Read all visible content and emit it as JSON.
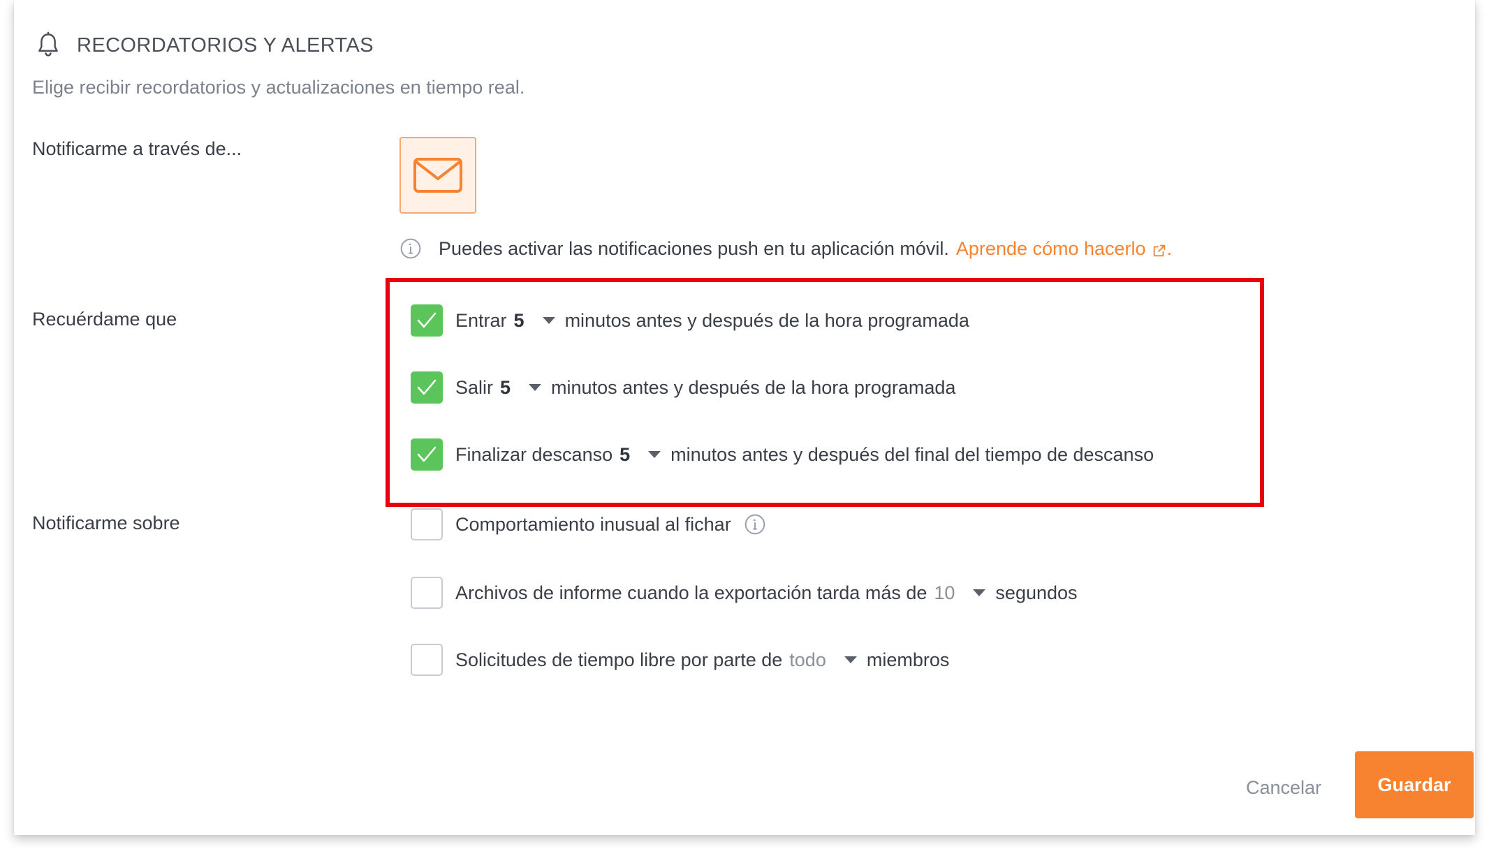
{
  "header": {
    "title": "RECORDATORIOS Y ALERTAS",
    "subtitle": "Elige recibir recordatorios y actualizaciones en tiempo real.",
    "icon": "bell-icon"
  },
  "notify_via": {
    "label": "Notificarme a través de...",
    "channel_icon": "envelope-icon",
    "accent_color": "#f7822f",
    "push_info_text": "Puedes activar las notificaciones push en tu aplicación móvil.",
    "push_info_link": "Aprende cómo hacerlo",
    "push_info_suffix": "."
  },
  "remind": {
    "label": "Recuérdame que",
    "items": [
      {
        "checked": true,
        "label": "Entrar",
        "value": "5",
        "suffix": "minutos antes y después de la hora programada"
      },
      {
        "checked": true,
        "label": "Salir",
        "value": "5",
        "suffix": "minutos antes y después de la hora programada"
      },
      {
        "checked": true,
        "label": "Finalizar descanso",
        "value": "5",
        "suffix": "minutos antes y después del final del tiempo de descanso"
      }
    ]
  },
  "notify_about": {
    "label": "Notificarme sobre",
    "items": [
      {
        "checked": false,
        "label": "Comportamiento inusual al fichar"
      },
      {
        "checked": false,
        "label": "Archivos de informe cuando la exportación tarda más de",
        "value": "10",
        "suffix": "segundos"
      },
      {
        "checked": false,
        "label": "Solicitudes de tiempo libre por parte de",
        "value": "todo",
        "suffix": "miembros"
      }
    ]
  },
  "footer": {
    "cancel_label": "Cancelar",
    "save_label": "Guardar"
  },
  "colors": {
    "checkbox_checked": "#5bc55b",
    "highlight_border": "#e8000d",
    "save_button": "#f7822f"
  }
}
